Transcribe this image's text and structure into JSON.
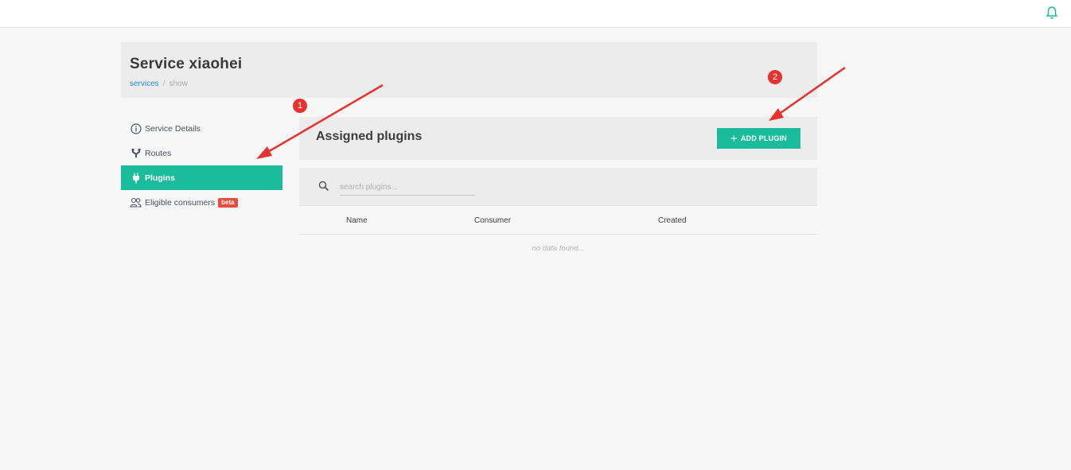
{
  "header": {
    "title": "Service xiaohei",
    "breadcrumb": [
      {
        "label": "services"
      },
      {
        "label": "show"
      }
    ],
    "breadcrumb_separator": "/"
  },
  "topbar": {
    "notifications_icon": "bell-icon"
  },
  "sidebar": {
    "items": [
      {
        "label": "Service Details",
        "icon": "info-circle-icon",
        "active": false
      },
      {
        "label": "Routes",
        "icon": "routes-fork-icon",
        "active": false
      },
      {
        "label": "Plugins",
        "icon": "plug-icon",
        "active": true
      },
      {
        "label": "Eligible consumers",
        "icon": "users-icon",
        "active": false,
        "badge": "beta"
      }
    ]
  },
  "main": {
    "panel_title": "Assigned plugins",
    "add_button_label": "ADD PLUGIN",
    "search": {
      "placeholder": "search plugins..."
    },
    "table": {
      "columns": [
        "Name",
        "Consumer",
        "Created"
      ],
      "empty_text": "no data found..."
    }
  },
  "annotations": {
    "badges": [
      "1",
      "2"
    ]
  },
  "colors": {
    "accent": "#1abc9c",
    "badge": "#e74c3c",
    "annotation": "#e8322f",
    "link": "#2d8bd1"
  }
}
